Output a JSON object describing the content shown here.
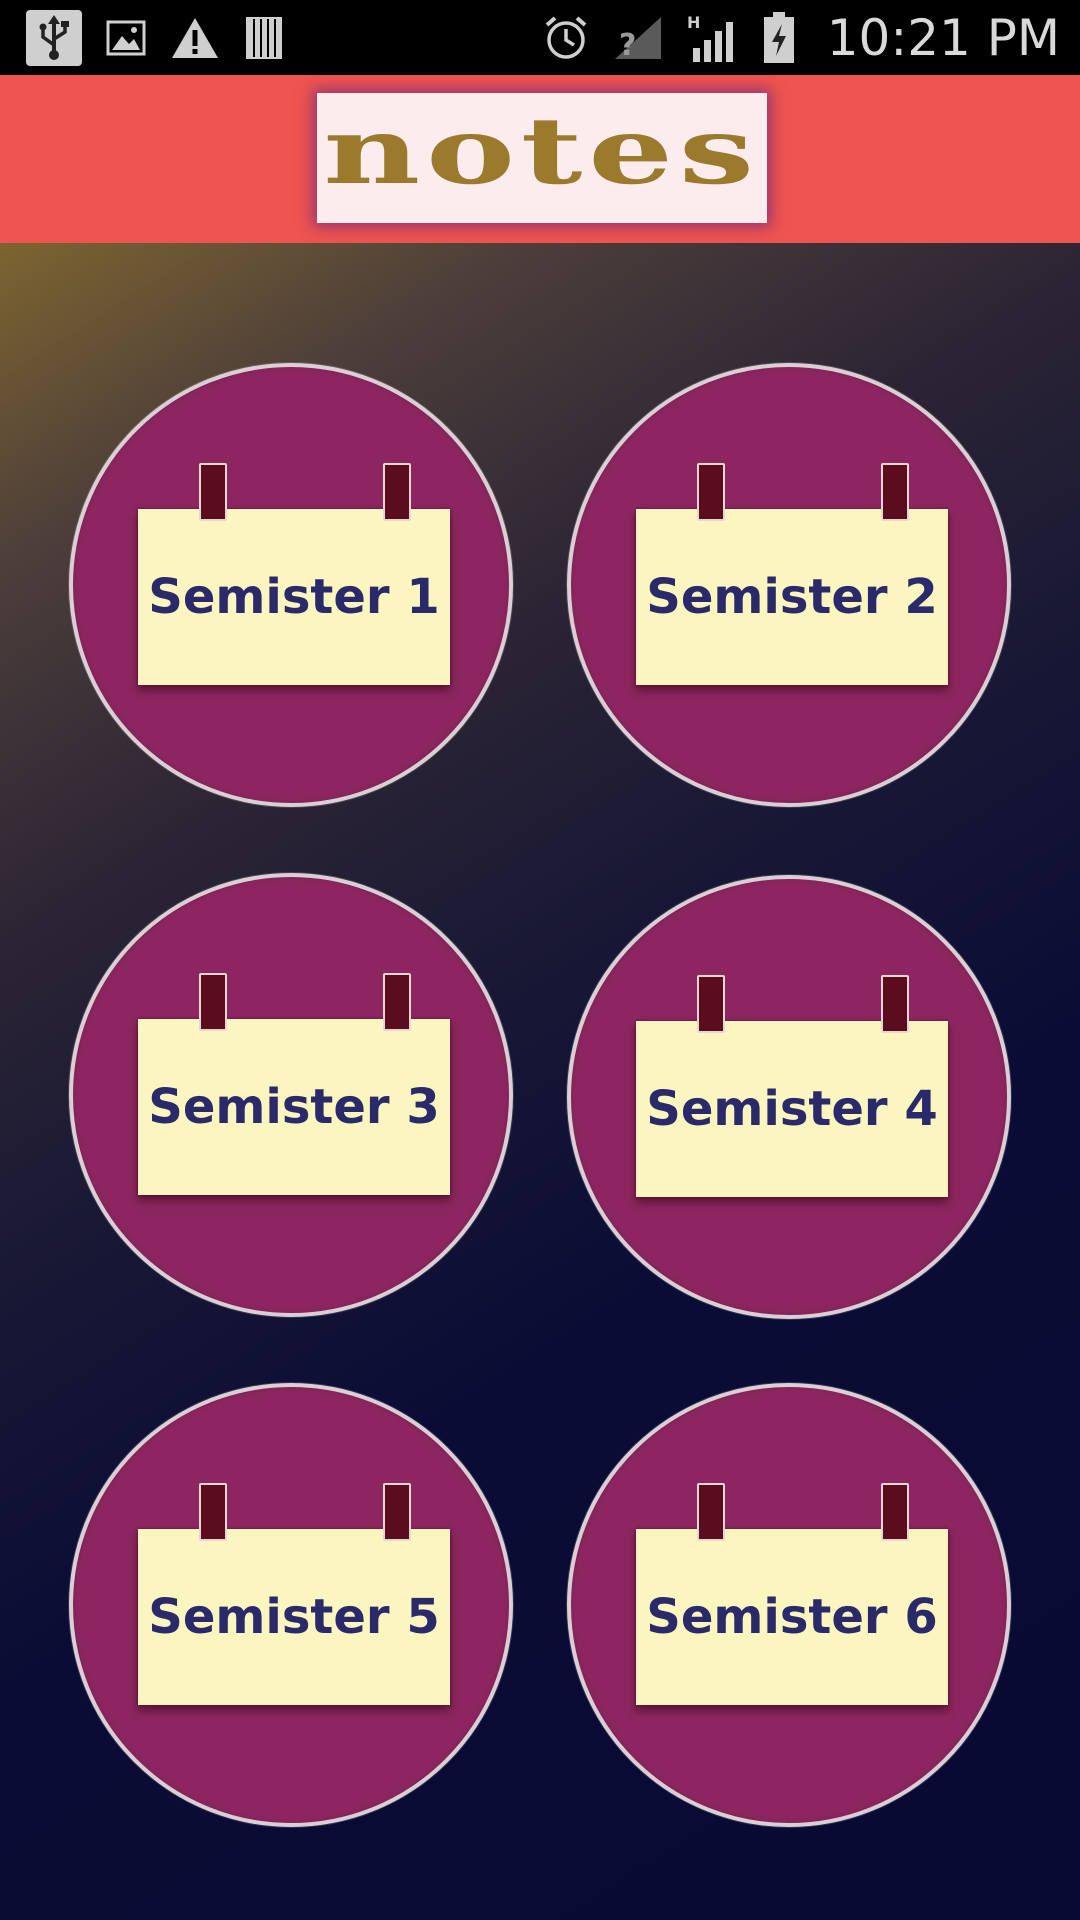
{
  "status_bar": {
    "time": "10:21 PM",
    "left_icons": [
      "usb-icon",
      "image-icon",
      "warning-icon",
      "sim-toolkit-icon"
    ],
    "right_icons": [
      "alarm-icon",
      "no-sim-signal-icon",
      "h-signal-icon",
      "battery-charging-icon"
    ],
    "network_type": "H"
  },
  "header": {
    "title": "notes"
  },
  "semesters": [
    {
      "label": "Semister 1"
    },
    {
      "label": "Semister 2"
    },
    {
      "label": "Semister 3"
    },
    {
      "label": "Semister 4"
    },
    {
      "label": "Semister 5"
    },
    {
      "label": "Semister 6"
    }
  ],
  "colors": {
    "header_bg": "#ef5450",
    "logo_text": "#9b7a2e",
    "circle_bg": "#8d2660",
    "note_bg": "#fbf6c0",
    "note_text": "#2a2a6a"
  }
}
